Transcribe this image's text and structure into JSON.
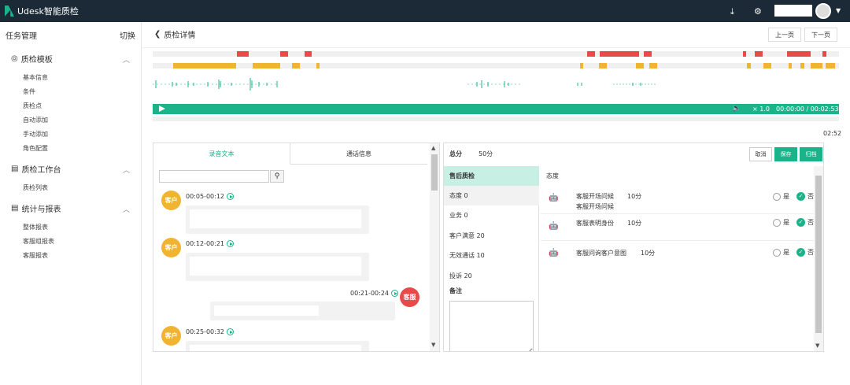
{
  "app": {
    "title": "Udesk智能质检"
  },
  "sidebar": {
    "header": "任务管理",
    "switch_label": "切换",
    "groups": [
      {
        "label": "质检模板",
        "items": [
          "基本信息",
          "条件",
          "质检点",
          "自动添加",
          "手动添加",
          "角色配置"
        ]
      },
      {
        "label": "质检工作台",
        "items": [
          "质检列表"
        ]
      },
      {
        "label": "统计与报表",
        "items": [
          "整体报表",
          "客服组报表",
          "客服报表"
        ]
      }
    ]
  },
  "page": {
    "title": "质检详情",
    "prev_label": "上一页",
    "next_label": "下一页"
  },
  "player": {
    "speed": "× 1.0",
    "time": "00:00:00 / 00:02:53",
    "duration": "02:52"
  },
  "transcript": {
    "tabs": [
      "录音文本",
      "通话信息"
    ],
    "search_placeholder": "",
    "messages": [
      {
        "speaker": "客户",
        "time": "00:05-00:12"
      },
      {
        "speaker": "客户",
        "time": "00:12-00:21"
      },
      {
        "speaker": "客服",
        "time": "00:21-00:24"
      },
      {
        "speaker": "客户",
        "time": "00:25-00:32"
      }
    ]
  },
  "scoring": {
    "total_label": "总分",
    "total_value": "50分",
    "buttons": [
      "取消",
      "保存",
      "归档"
    ],
    "categories": [
      {
        "label": "售后质检"
      },
      {
        "label": "态度 0"
      },
      {
        "label": "业务 0"
      },
      {
        "label": "客户满意 20"
      },
      {
        "label": "无效通话 10"
      },
      {
        "label": "投诉 20"
      }
    ],
    "remark_label": "备注",
    "section_title": "态度",
    "items": [
      {
        "name": "客服开场问候",
        "score": "10分",
        "sub": "客服开场问候"
      },
      {
        "name": "客服表明身份",
        "score": "10分"
      },
      {
        "name": "客服问询客户意图",
        "score": "10分"
      }
    ],
    "yes_label": "是",
    "no_label": "否"
  },
  "colors": {
    "accent": "#1ab38a",
    "topbar": "#1b2a36",
    "red_segment": "#e84a4a",
    "yellow_segment": "#f0b432",
    "customer_badge": "#f0b432",
    "agent_badge": "#e84a4a"
  }
}
